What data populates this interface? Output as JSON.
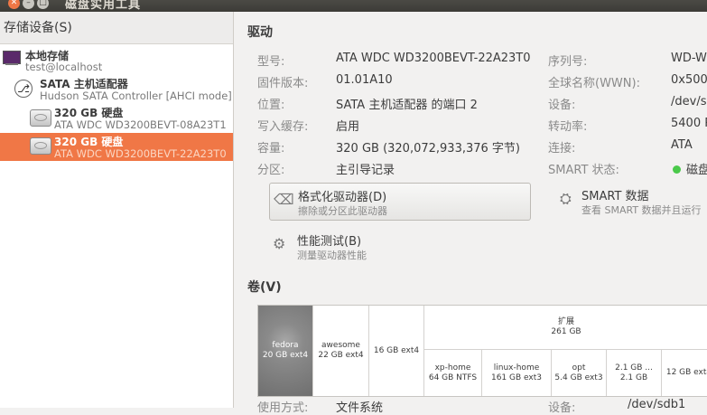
{
  "window": {
    "title": "磁盘实用工具"
  },
  "left": {
    "header": "存储设备(S)",
    "items": [
      {
        "name": "本地存储",
        "sub": "test@localhost"
      },
      {
        "name": "SATA 主机适配器",
        "sub": "Hudson SATA Controller [AHCI mode]"
      },
      {
        "name": "320 GB 硬盘",
        "sub": "ATA WDC WD3200BEVT-08A23T1"
      },
      {
        "name": "320 GB 硬盘",
        "sub": "ATA WDC WD3200BEVT-22A23T0"
      }
    ]
  },
  "drive": {
    "section_title": "驱动",
    "rows_left": [
      {
        "label": "型号:",
        "value": "ATA WDC WD3200BEVT-22A23T0"
      },
      {
        "label": "固件版本:",
        "value": "01.01A10"
      },
      {
        "label": "位置:",
        "value": "SATA 主机适配器 的端口 2"
      },
      {
        "label": "写入缓存:",
        "value": "启用"
      },
      {
        "label": "容量:",
        "value": "320 GB (320,072,933,376 字节)"
      },
      {
        "label": "分区:",
        "value": "主引导记录"
      }
    ],
    "rows_right": [
      {
        "label": "序列号:",
        "value": "WD-W"
      },
      {
        "label": "全球名称(WWN):",
        "value": "0x500"
      },
      {
        "label": "设备:",
        "value": "/dev/s"
      },
      {
        "label": "转动率:",
        "value": "5400 R"
      },
      {
        "label": "连接:",
        "value": "ATA"
      },
      {
        "label": "SMART 状态:",
        "value": "磁盘"
      }
    ],
    "actions": {
      "format": {
        "title": "格式化驱动器(D)",
        "desc": "擦除或分区此驱动器"
      },
      "smart": {
        "title": "SMART 数据",
        "desc": "查看 SMART 数据并且运行"
      },
      "bench": {
        "title": "性能测试(B)",
        "desc": "测量驱动器性能"
      }
    }
  },
  "volumes": {
    "section_title": "卷(V)",
    "extended": {
      "name": "扩展",
      "size": "261 GB"
    },
    "cells": [
      {
        "name": "fedora",
        "size": "20 GB ext4"
      },
      {
        "name": "awesome",
        "size": "22 GB ext4"
      },
      {
        "name": "",
        "size": "16 GB ext4"
      },
      {
        "name": "xp-home",
        "size": "64 GB NTFS"
      },
      {
        "name": "linux-home",
        "size": "161 GB ext3"
      },
      {
        "name": "opt",
        "size": "5.4 GB ext3"
      },
      {
        "name": "2.1 GB ...",
        "size": "2.1 GB"
      },
      {
        "name": "",
        "size": "12 GB ext4"
      }
    ]
  },
  "bottom": {
    "label1": "使用方式:",
    "value1": "文件系统",
    "label2": "设备:",
    "value2": "/dev/sdb1"
  }
}
